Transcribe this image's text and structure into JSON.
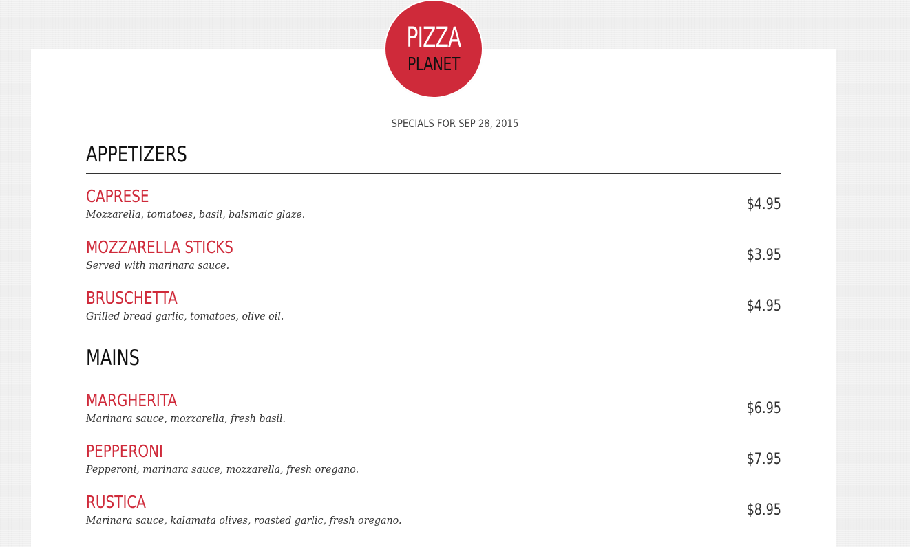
{
  "logo": {
    "line1": "PIZZA",
    "line2": "PLANET"
  },
  "specials": "SPECIALS FOR SEP 28, 2015",
  "sections": [
    {
      "title": "APPETIZERS",
      "items": [
        {
          "name": "CAPRESE",
          "description": "Mozzarella, tomatoes, basil, balsmaic glaze.",
          "price": "$4.95"
        },
        {
          "name": "MOZZARELLA STICKS",
          "description": "Served with marinara sauce.",
          "price": "$3.95"
        },
        {
          "name": "BRUSCHETTA",
          "description": "Grilled bread garlic, tomatoes, olive oil.",
          "price": "$4.95"
        }
      ]
    },
    {
      "title": "MAINS",
      "items": [
        {
          "name": "MARGHERITA",
          "description": "Marinara sauce, mozzarella, fresh basil.",
          "price": "$6.95"
        },
        {
          "name": "PEPPERONI",
          "description": "Pepperoni, marinara sauce, mozzarella, fresh oregano.",
          "price": "$7.95"
        },
        {
          "name": "RUSTICA",
          "description": "Marinara sauce, kalamata olives, roasted garlic, fresh oregano.",
          "price": "$8.95"
        }
      ]
    }
  ],
  "colors": {
    "brand_red": "#cf2a3a",
    "background": "#efefef",
    "card": "#ffffff",
    "text_dark": "#111111"
  }
}
